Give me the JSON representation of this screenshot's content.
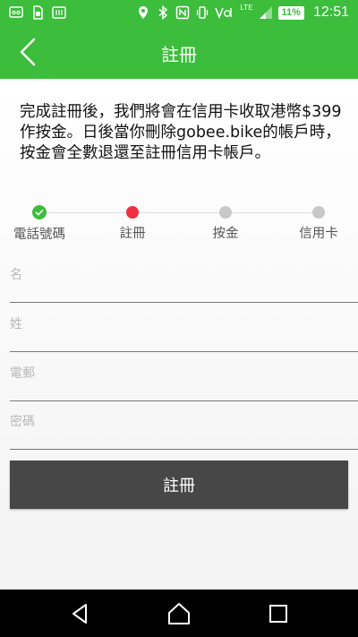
{
  "status_bar": {
    "battery": "11%",
    "network": "LTE",
    "time": "12:51",
    "left_icons": [
      "voicemail-icon",
      "sim-card-icon",
      "keyboard-icon"
    ],
    "right_icons": [
      "location-icon",
      "bluetooth-icon",
      "nfc-icon",
      "vibrate-icon",
      "volte-icon",
      "signal-icon",
      "battery-icon"
    ]
  },
  "app_bar": {
    "title": "註冊",
    "color": "#3cbd3c"
  },
  "intro_text": "完成註冊後，我們將會在信用卡收取港幣$399作按金。日後當你刪除gobee.bike的帳戶時，按金會全數退還至註冊信用卡帳戶。",
  "steps": [
    {
      "label": "電話號碼",
      "state": "done"
    },
    {
      "label": "註冊",
      "state": "active"
    },
    {
      "label": "按金",
      "state": "pending"
    },
    {
      "label": "信用卡",
      "state": "pending"
    }
  ],
  "form": {
    "first_name": {
      "placeholder": "名",
      "value": ""
    },
    "last_name": {
      "placeholder": "姓",
      "value": ""
    },
    "email": {
      "placeholder": "電郵",
      "value": ""
    },
    "password": {
      "placeholder": "密碼",
      "value": ""
    }
  },
  "submit_label": "註冊",
  "nav_bar": {
    "icons": [
      "back-icon",
      "home-icon",
      "recents-icon"
    ]
  }
}
